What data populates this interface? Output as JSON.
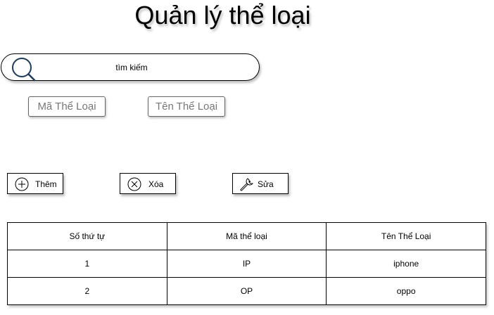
{
  "page": {
    "title": "Quản lý thể loại"
  },
  "search": {
    "placeholder": "tìm kiếm",
    "icon": "search-icon"
  },
  "filters": {
    "ma_label": "Mã Thể Loại",
    "ten_label": "Tên Thể Loại"
  },
  "actions": {
    "them_label": "Thêm",
    "xoa_label": "Xóa",
    "sua_label": "Sửa",
    "them_icon": "plus-circle-icon",
    "xoa_icon": "close-circle-icon",
    "sua_icon": "wrench-icon"
  },
  "table": {
    "headers": [
      "Số thứ tự",
      "Mã thể loại",
      "Tên Thể Loại"
    ],
    "rows": [
      [
        "1",
        "IP",
        "iphone"
      ],
      [
        "2",
        "OP",
        "oppo"
      ]
    ]
  },
  "colors": {
    "search_icon": "#1f3b57",
    "filter_text": "#777777",
    "border": "#000000"
  }
}
